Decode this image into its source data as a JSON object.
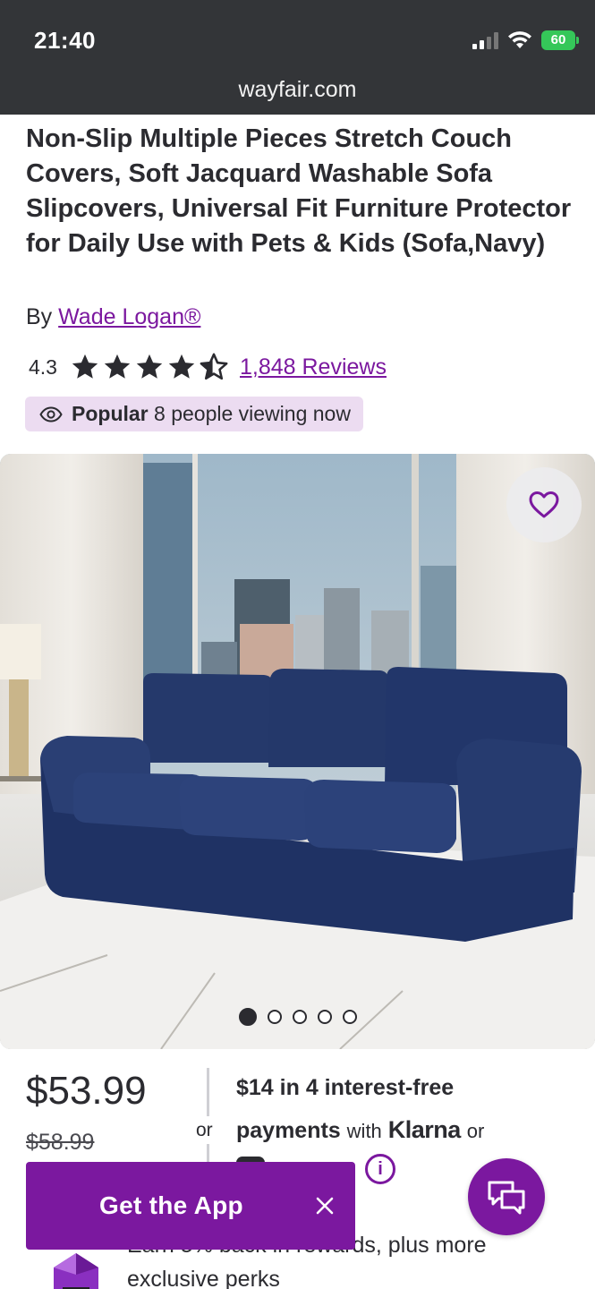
{
  "status_bar": {
    "time": "21:40",
    "battery": "60",
    "url": "wayfair.com",
    "icons": [
      "signal-icon",
      "wifi-icon",
      "battery-charging-icon"
    ]
  },
  "product": {
    "title": "Non-Slip Multiple Pieces Stretch Couch Covers, Soft Jacquard Washable Sofa Slipcovers, Universal Fit Furniture Protector for Daily Use with Pets & Kids (Sofa,Navy)",
    "by_label": "By",
    "brand": "Wade Logan®",
    "rating": "4.3",
    "rating_stars": 4.3,
    "reviews_label": "1,848 Reviews",
    "popular_label": "Popular",
    "viewing_text": "8 people viewing now",
    "image_count": 5,
    "active_image": 1
  },
  "pricing": {
    "price": "$53.99",
    "old_price": "$58.99",
    "or_label": "or",
    "installment_line1": "$14 in 4 interest-free",
    "installment_payments": "payments",
    "installment_with": "with",
    "installment_provider": "Klarna",
    "installment_or": "or",
    "info_icon": "i"
  },
  "rewards": {
    "text": "Earn 5% back in rewards, plus more exclusive perks"
  },
  "app_banner": {
    "label": "Get the App"
  },
  "colors": {
    "brand_purple": "#7b189f",
    "badge_bg": "#ecdcf1",
    "status_bar_bg": "#333538",
    "sofa_navy": "#23386a"
  }
}
